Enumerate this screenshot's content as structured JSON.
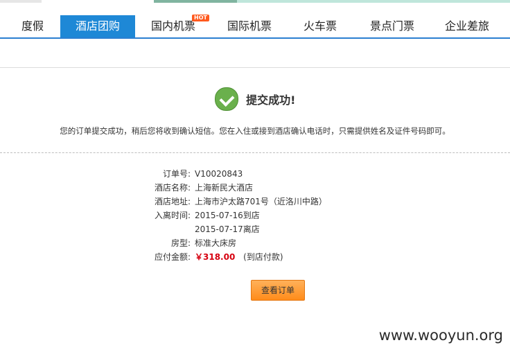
{
  "nav": {
    "items": [
      {
        "label": "度假"
      },
      {
        "label": "酒店团购"
      },
      {
        "label": "国内机票",
        "badge": "HOT"
      },
      {
        "label": "国际机票"
      },
      {
        "label": "火车票"
      },
      {
        "label": "景点门票"
      },
      {
        "label": "企业差旅"
      }
    ],
    "active_index": 1
  },
  "success": {
    "title": "提交成功!",
    "icon": "check-circle-icon"
  },
  "notice": "您的订单提交成功，稍后您将收到确认短信。您在入住或接到酒店确认电话时，只需提供姓名及证件号码即可。",
  "order": {
    "order_no_label": "订单号:",
    "order_no": "V10020843",
    "hotel_name_label": "酒店名称:",
    "hotel_name": "上海新民大酒店",
    "hotel_address_label": "酒店地址:",
    "hotel_address": "上海市沪太路701号（近洛川中路）",
    "stay_label": "入离时间:",
    "checkin": "2015-07-16到店",
    "checkout": "2015-07-17离店",
    "room_label": "房型:",
    "room": "标准大床房",
    "amount_label": "应付金额:",
    "amount": "￥318.00",
    "payment_note": "(到店付款)"
  },
  "buttons": {
    "view_order": "查看订单"
  },
  "watermark": "www.wooyun.org",
  "colors": {
    "nav_active": "#1e88d6",
    "price": "#d6000f",
    "button": "#ff8c1a",
    "success_icon": "#6ab04c"
  }
}
